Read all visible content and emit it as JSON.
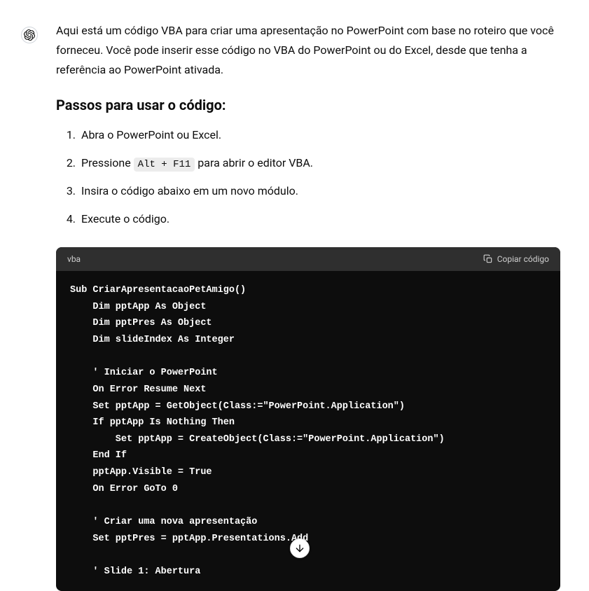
{
  "intro": "Aqui está um código VBA para criar uma apresentação no PowerPoint com base no roteiro que você forneceu. Você pode inserir esse código no VBA do PowerPoint ou do Excel, desde que tenha a referência ao PowerPoint ativada.",
  "steps_heading": "Passos para usar o código:",
  "steps": [
    {
      "text_before": "Abra o PowerPoint ou Excel."
    },
    {
      "text_before": "Pressione ",
      "code": "Alt + F11",
      "text_after": " para abrir o editor VBA."
    },
    {
      "text_before": "Insira o código abaixo em um novo módulo."
    },
    {
      "text_before": "Execute o código."
    }
  ],
  "code_block": {
    "language": "vba",
    "copy_label": "Copiar código",
    "content": "Sub CriarApresentacaoPetAmigo()\n    Dim pptApp As Object\n    Dim pptPres As Object\n    Dim slideIndex As Integer\n\n    ' Iniciar o PowerPoint\n    On Error Resume Next\n    Set pptApp = GetObject(Class:=\"PowerPoint.Application\")\n    If pptApp Is Nothing Then\n        Set pptApp = CreateObject(Class:=\"PowerPoint.Application\")\n    End If\n    pptApp.Visible = True\n    On Error GoTo 0\n\n    ' Criar uma nova apresentação\n    Set pptPres = pptApp.Presentations.Add\n\n    ' Slide 1: Abertura"
  }
}
